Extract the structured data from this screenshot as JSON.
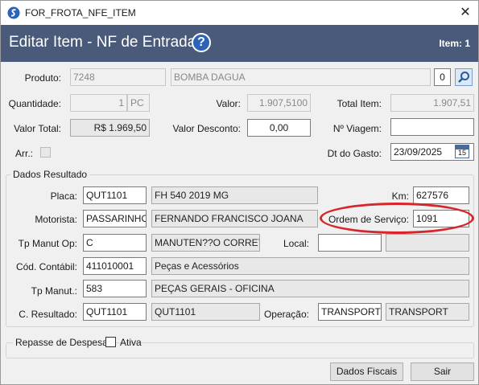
{
  "window": {
    "title": "FOR_FROTA_NFE_ITEM",
    "close_label": "✕"
  },
  "header": {
    "title": "Editar Item - NF de Entrada",
    "help_label": "?",
    "item_label": "Item: 1"
  },
  "produto": {
    "label": "Produto:",
    "code": "7248",
    "name": "BOMBA DAGUA",
    "qty_box": "0"
  },
  "quantidade": {
    "label": "Quantidade:",
    "value": "1",
    "unit": "PC"
  },
  "valor": {
    "label": "Valor:",
    "value": "1.907,5100"
  },
  "total_item": {
    "label": "Total Item:",
    "value": "1.907,51"
  },
  "valor_total": {
    "label": "Valor Total:",
    "value": "R$ 1.969,50"
  },
  "valor_desconto": {
    "label": "Valor Desconto:",
    "value": "0,00"
  },
  "n_viagem": {
    "label": "Nº Viagem:",
    "value": ""
  },
  "arr": {
    "label": "Arr.:"
  },
  "dt_gasto": {
    "label": "Dt do Gasto:",
    "value": "23/09/2025",
    "cal_day": "15"
  },
  "dados_resultado": {
    "title": "Dados Resultado",
    "placa": {
      "label": "Placa:",
      "code": "QUT1101",
      "desc": "FH 540 2019 MG"
    },
    "km": {
      "label": "Km:",
      "value": "627576"
    },
    "motorista": {
      "label": "Motorista:",
      "code": "PASSARINHO",
      "name": "FERNANDO FRANCISCO JOANA"
    },
    "ordem_servico": {
      "label": "Ordem de Serviço:",
      "value": "1091"
    },
    "tp_manut_op": {
      "label": "Tp Manut Op:",
      "code": "C",
      "desc": "MANUTEN??O CORRETIV"
    },
    "local": {
      "label": "Local:",
      "code": "",
      "desc": ""
    },
    "cod_contabil": {
      "label": "Cód. Contábil:",
      "code": "411010001",
      "desc": "Peças e Acessórios"
    },
    "tp_manut": {
      "label": "Tp Manut.:",
      "code": "583",
      "desc": "PEÇAS GERAIS - OFICINA"
    },
    "c_resultado": {
      "label": "C. Resultado:",
      "code": "QUT1101",
      "desc": "QUT1101"
    },
    "operacao": {
      "label": "Operação:",
      "code": "TRANSPORTE",
      "desc": "TRANSPORT"
    }
  },
  "repasse": {
    "title": "Repasse de Despesa",
    "ativa_label": "Ativa"
  },
  "buttons": {
    "dados_fiscais": "Dados Fiscais",
    "sair": "Sair"
  },
  "colors": {
    "header_bg": "#4a5a7a",
    "highlight_oval": "#d7262b"
  }
}
